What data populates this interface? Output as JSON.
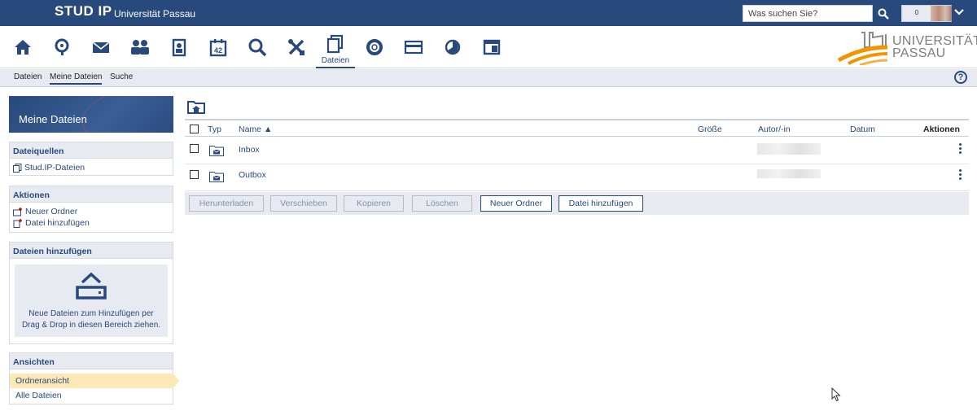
{
  "header": {
    "logo_text": "STUD IP",
    "logo_sup": "®",
    "university": "Universität Passau",
    "search_placeholder": "Was suchen Sie?",
    "notification_count": "0"
  },
  "nav": {
    "active_label": "Dateien",
    "icons": [
      "home-icon",
      "seminar-icon",
      "mail-icon",
      "community-icon",
      "profile-icon",
      "calendar-icon",
      "search-icon",
      "tools-icon",
      "files-icon",
      "help-lifebuoy-icon",
      "card-icon",
      "pie-icon",
      "layout-icon"
    ]
  },
  "brand": {
    "line1": "UNIVERSITÄT",
    "line2": "PASSAU"
  },
  "subnav": {
    "items": [
      "Dateien",
      "Meine Dateien",
      "Suche"
    ],
    "active": "Meine Dateien",
    "help": "?"
  },
  "sidebar": {
    "title": "Meine Dateien",
    "sources": {
      "heading": "Dateiquellen",
      "items": [
        "Stud.IP-Dateien"
      ]
    },
    "actions": {
      "heading": "Aktionen",
      "items": [
        "Neuer Ordner",
        "Datei hinzufügen"
      ]
    },
    "add_files": {
      "heading": "Dateien hinzufügen",
      "text_line1": "Neue Dateien zum Hinzufügen per",
      "text_line2": "Drag & Drop in diesen Bereich ziehen."
    },
    "views": {
      "heading": "Ansichten",
      "items": [
        "Ordneransicht",
        "Alle Dateien"
      ],
      "active": "Ordneransicht"
    }
  },
  "table": {
    "columns": {
      "type": "Typ",
      "name": "Name",
      "size": "Größe",
      "author": "Autor/-in",
      "date": "Datum",
      "actions": "Aktionen"
    },
    "sort_indicator": "▲",
    "rows": [
      {
        "name": "Inbox"
      },
      {
        "name": "Outbox"
      }
    ]
  },
  "buttons": {
    "download": "Herunterladen",
    "move": "Verschieben",
    "copy": "Kopieren",
    "delete": "Löschen",
    "new_folder": "Neuer Ordner",
    "add_file": "Datei hinzufügen"
  },
  "colors": {
    "primary": "#28497c",
    "panel": "#e7ebf1",
    "highlight": "#fde8b8",
    "brand_orange": "#f29400"
  }
}
